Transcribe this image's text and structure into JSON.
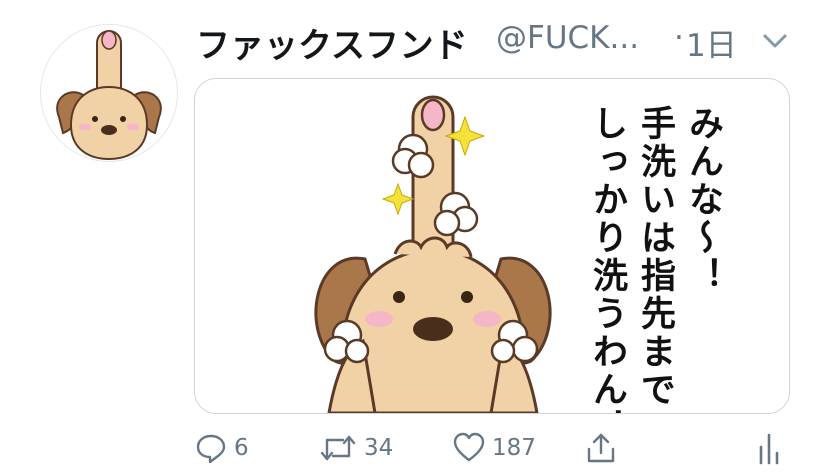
{
  "tweet": {
    "display_name": "ファックスフンド",
    "handle": "@FUCK...",
    "separator": "·",
    "time": "1日",
    "media": {
      "lines": [
        "みんな〜！",
        "手洗いは指先まで",
        "しっかり洗うわん！"
      ]
    },
    "actions": {
      "reply_count": "6",
      "retweet_count": "34",
      "like_count": "187"
    }
  },
  "colors": {
    "text_primary": "#14171a",
    "text_secondary": "#657786",
    "border": "#ccd6dd",
    "dog_fur": "#f1d2a6",
    "dog_ear": "#a9774a",
    "outline": "#5a3a26"
  },
  "icons": [
    "caret-down-icon",
    "reply-icon",
    "retweet-icon",
    "like-icon",
    "share-icon",
    "analytics-icon"
  ]
}
